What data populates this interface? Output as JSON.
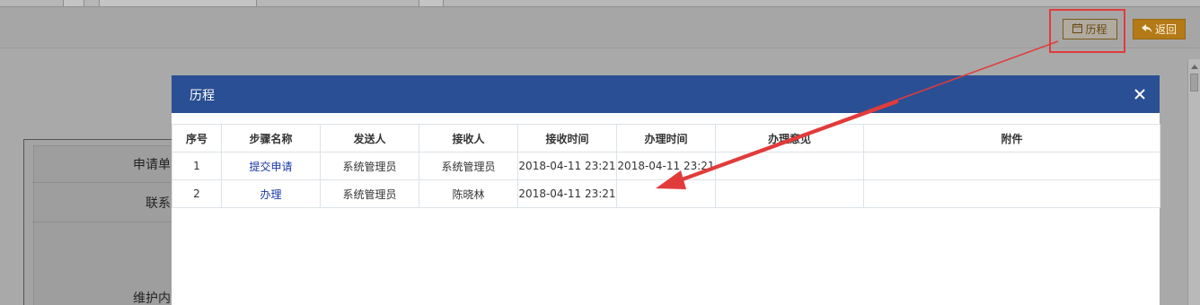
{
  "toolbar": {
    "history_label": "历程",
    "back_label": "返回"
  },
  "background_form": {
    "labels": [
      "申请单",
      "联系",
      "维护内"
    ]
  },
  "modal": {
    "title": "历程",
    "table": {
      "headers": [
        "序号",
        "步骤名称",
        "发送人",
        "接收人",
        "接收时间",
        "办理时间",
        "办理意见",
        "附件"
      ],
      "rows": [
        {
          "index": "1",
          "step": "提交申请",
          "sender": "系统管理员",
          "receiver": "系统管理员",
          "received_at": "2018-04-11 23:21",
          "handled_at": "2018-04-11 23:21",
          "opinion": "",
          "attachment": ""
        },
        {
          "index": "2",
          "step": "办理",
          "sender": "系统管理员",
          "receiver": "陈晓林",
          "received_at": "2018-04-11 23:21",
          "handled_at": "",
          "opinion": "",
          "attachment": ""
        }
      ]
    }
  },
  "colors": {
    "modal_header": "#2b4f94",
    "annotation_red": "#e23b3b",
    "back_button": "#b47a18",
    "link": "#1a36a8"
  },
  "icons": {
    "history": "calendar-icon",
    "back": "reply-arrow-icon",
    "close": "close-icon"
  }
}
